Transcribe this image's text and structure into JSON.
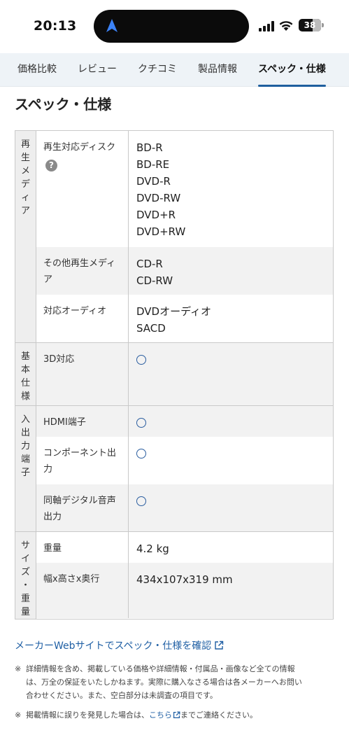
{
  "status": {
    "time": "20:13",
    "battery": "38"
  },
  "tabs": [
    {
      "label": "価格比較",
      "active": false
    },
    {
      "label": "レビュー",
      "active": false
    },
    {
      "label": "クチコミ",
      "active": false
    },
    {
      "label": "製品情報",
      "active": false
    },
    {
      "label": "スペック・仕様",
      "active": true
    }
  ],
  "page": {
    "title": "スペック・仕様"
  },
  "spec": {
    "groups": [
      {
        "label": "再生メディア",
        "rows": [
          {
            "label": "再生対応ディスク",
            "help": "?",
            "values": [
              "BD-R",
              "BD-RE",
              "DVD-R",
              "DVD-RW",
              "DVD+R",
              "DVD+RW"
            ]
          },
          {
            "label": "その他再生メディア",
            "values": [
              "CD-R",
              "CD-RW"
            ]
          },
          {
            "label": "対応オーディオ",
            "values": [
              "DVDオーディオ",
              "SACD"
            ]
          }
        ]
      },
      {
        "label": "基本仕様",
        "rows": [
          {
            "label": "3D対応",
            "circle": true
          }
        ]
      },
      {
        "label": "入出力端子",
        "rows": [
          {
            "label": "HDMI端子",
            "circle": true
          },
          {
            "label": "コンポーネント出力",
            "circle": true
          },
          {
            "label": "同軸デジタル音声出力",
            "circle": true
          }
        ]
      },
      {
        "label": "サイズ・重量",
        "rows": [
          {
            "label": "重量",
            "values": [
              "4.2 kg"
            ]
          },
          {
            "label": "幅x高さx奥行",
            "values": [
              "434x107x319 mm"
            ]
          }
        ]
      }
    ]
  },
  "footer": {
    "maker_link": "メーカーWebサイトでスペック・仕様を確認",
    "note_mark": "※",
    "note1": "詳細情報を含め、掲載している価格や詳細情報・付属品・画像など全ての情報は、万全の保証をいたしかねます。実際に購入なさる場合は各メーカーへお問い合わせください。また、空白部分は未調査の項目です。",
    "note2_before": "掲載情報に誤りを発見した場合は、",
    "note2_link": "こちら",
    "note2_after": "までご連絡ください。"
  },
  "colors": {
    "accent": "#1f5f9e",
    "link": "#1f5fa4",
    "tab_bg": "#eef3f7",
    "label_bg": "#eeeeee"
  }
}
